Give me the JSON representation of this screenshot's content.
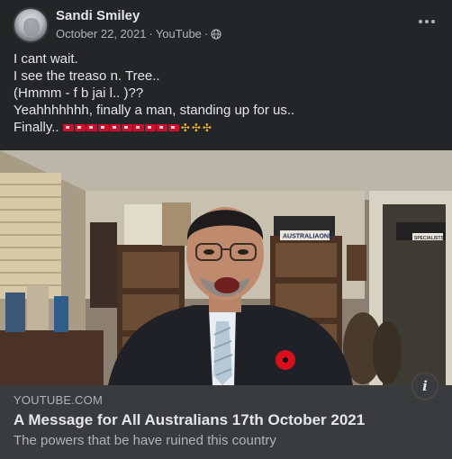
{
  "post": {
    "author": "Sandi Smiley",
    "date": "October 22, 2021",
    "separator": "·",
    "source_app": "YouTube",
    "icons": {
      "audience": "globe-icon",
      "more": "ellipsis-icon",
      "info": "info-icon"
    },
    "lines": [
      "I cant wait.",
      "I see the treaso n. Tree..",
      "(Hmmm - f b jai l.. )??",
      "Yeahhhhhhh, finally a man, standing up for us..",
      "Finally.."
    ],
    "emoji_flags_count": 10,
    "emoji_pray_count": 3
  },
  "video": {
    "overlay_sign": "AUSTRALIAONE",
    "shelf_sign": "SPECIALISTS"
  },
  "link": {
    "source": "YOUTUBE.COM",
    "title": "A Message for All Australians 17th October 2021",
    "description": "The powers that be have ruined this country"
  },
  "colors": {
    "background": "#242526",
    "card": "#3a3b3c",
    "text_primary": "#e4e6eb",
    "text_secondary": "#b0b3b8",
    "poppy": "#d6101c"
  }
}
